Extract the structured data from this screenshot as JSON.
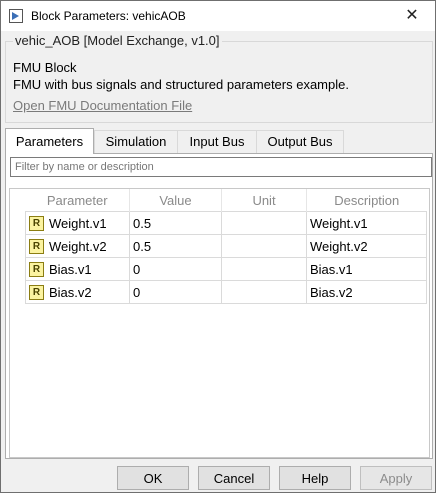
{
  "window": {
    "title": "Block Parameters: vehicAOB",
    "close_glyph": "✕"
  },
  "block": {
    "legend": "vehic_AOB [Model Exchange, v1.0]",
    "type": "FMU Block",
    "description": "FMU with bus signals and structured parameters example.",
    "doc_link": "Open FMU Documentation File"
  },
  "tabs": [
    {
      "label": "Parameters",
      "active": true
    },
    {
      "label": "Simulation",
      "active": false
    },
    {
      "label": "Input Bus",
      "active": false
    },
    {
      "label": "Output Bus",
      "active": false
    }
  ],
  "filter": {
    "placeholder": "Filter by name or description",
    "value": ""
  },
  "table": {
    "columns": [
      "Parameter",
      "Value",
      "Unit",
      "Description"
    ],
    "rows": [
      {
        "badge": "R",
        "name": "Weight.v1",
        "value": "0.5",
        "unit": "",
        "description": "Weight.v1"
      },
      {
        "badge": "R",
        "name": "Weight.v2",
        "value": "0.5",
        "unit": "",
        "description": "Weight.v2"
      },
      {
        "badge": "R",
        "name": "Bias.v1",
        "value": "0",
        "unit": "",
        "description": "Bias.v1"
      },
      {
        "badge": "R",
        "name": "Bias.v2",
        "value": "0",
        "unit": "",
        "description": "Bias.v2"
      }
    ]
  },
  "buttons": {
    "ok": {
      "label": "OK",
      "enabled": true
    },
    "cancel": {
      "label": "Cancel",
      "enabled": true
    },
    "help": {
      "label": "Help",
      "enabled": true
    },
    "apply": {
      "label": "Apply",
      "enabled": false
    }
  },
  "colors": {
    "badge_fill": "#fbf3a0",
    "badge_border": "#8b7d12",
    "link": "#7a7a7a"
  }
}
